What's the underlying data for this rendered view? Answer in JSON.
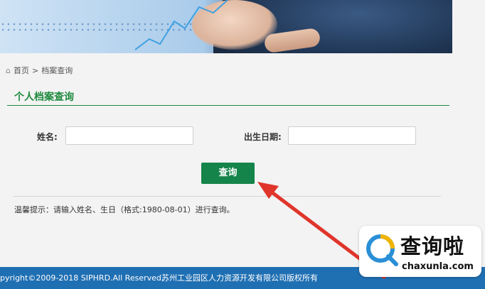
{
  "breadcrumb": {
    "home": "首页",
    "separator": ">",
    "current": "档案查询"
  },
  "section": {
    "title": "个人档案查询"
  },
  "form": {
    "name_label": "姓名:",
    "name_value": "",
    "birth_label": "出生日期:",
    "birth_value": "",
    "submit_label": "查询"
  },
  "tip": "温馨提示：请输入姓名、生日（格式:1980-08-01）进行查询。",
  "footer": {
    "copyright": "pyright©2009-2018 SIPHRD.All Reserved.",
    "owner": "苏州工业园区人力资源开发有限公司版权所有"
  },
  "watermark": {
    "cn": "查询啦",
    "en": "chaxunla.com"
  },
  "colors": {
    "accent_green": "#15844a",
    "title_green": "#1e8a3e",
    "footer_blue": "#1f6fb3",
    "arrow_red": "#e0352b"
  }
}
